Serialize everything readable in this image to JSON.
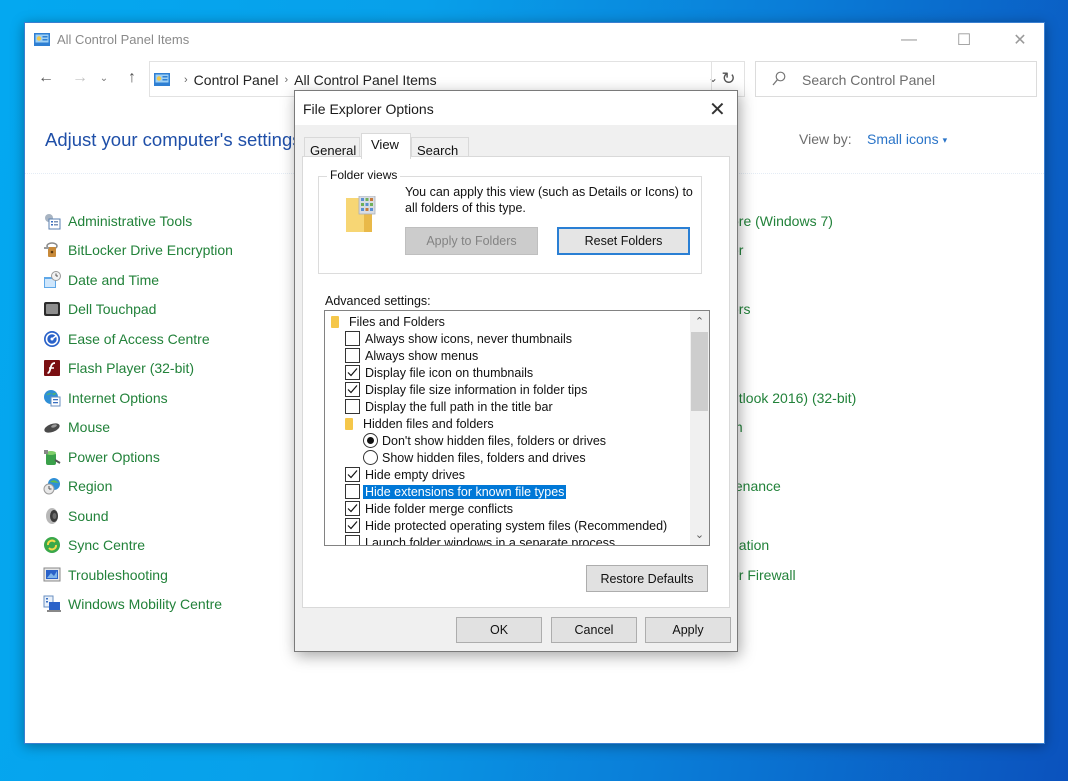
{
  "window": {
    "title": "All Control Panel Items",
    "controls": {
      "minimize": "—",
      "maximize": "☐",
      "close": "✕"
    }
  },
  "nav": {
    "back": "←",
    "forward": "→",
    "recent": "⌄",
    "up": "↑",
    "breadcrumbs": [
      "Control Panel",
      "All Control Panel Items"
    ],
    "separator": "›",
    "dropdown": "⌄",
    "refresh": "↻"
  },
  "search": {
    "placeholder": "Search Control Panel"
  },
  "main": {
    "heading": "Adjust your computer's settings",
    "view_by_label": "View by:",
    "view_by_value": "Small icons",
    "view_by_caret": "▾",
    "items_left": [
      {
        "label": "Administrative Tools",
        "icon": "admin-tools-icon"
      },
      {
        "label": "BitLocker Drive Encryption",
        "icon": "bitlocker-icon"
      },
      {
        "label": "Date and Time",
        "icon": "date-time-icon"
      },
      {
        "label": "Dell Touchpad",
        "icon": "touchpad-icon"
      },
      {
        "label": "Ease of Access Centre",
        "icon": "ease-of-access-icon"
      },
      {
        "label": "Flash Player (32-bit)",
        "icon": "flash-player-icon"
      },
      {
        "label": "Internet Options",
        "icon": "internet-options-icon"
      },
      {
        "label": "Mouse",
        "icon": "mouse-icon"
      },
      {
        "label": "Power Options",
        "icon": "power-options-icon"
      },
      {
        "label": "Region",
        "icon": "region-icon"
      },
      {
        "label": "Sound",
        "icon": "sound-icon"
      },
      {
        "label": "Sync Centre",
        "icon": "sync-centre-icon"
      },
      {
        "label": "Troubleshooting",
        "icon": "troubleshooting-icon"
      },
      {
        "label": "Windows Mobility Centre",
        "icon": "mobility-centre-icon"
      }
    ],
    "items_right_partial": [
      "ore (Windows 7)",
      "er",
      "",
      "ers",
      "",
      "",
      "utlook 2016) (32-bit)",
      "m",
      "",
      "tenance",
      "",
      "gation",
      "er Firewall"
    ]
  },
  "dialog": {
    "title": "File Explorer Options",
    "close": "✕",
    "tabs": [
      "General",
      "View",
      "Search"
    ],
    "active_tab": "View",
    "folder_views": {
      "label": "Folder views",
      "description": "You can apply this view (such as Details or Icons) to all folders of this type.",
      "apply_button": "Apply to Folders",
      "reset_button": "Reset Folders"
    },
    "advanced_label": "Advanced settings:",
    "tree": [
      {
        "type": "folder",
        "level": 0,
        "label": "Files and Folders"
      },
      {
        "type": "checkbox",
        "level": 1,
        "label": "Always show icons, never thumbnails",
        "checked": false
      },
      {
        "type": "checkbox",
        "level": 1,
        "label": "Always show menus",
        "checked": false
      },
      {
        "type": "checkbox",
        "level": 1,
        "label": "Display file icon on thumbnails",
        "checked": true
      },
      {
        "type": "checkbox",
        "level": 1,
        "label": "Display file size information in folder tips",
        "checked": true
      },
      {
        "type": "checkbox",
        "level": 1,
        "label": "Display the full path in the title bar",
        "checked": false
      },
      {
        "type": "folder",
        "level": 1,
        "label": "Hidden files and folders"
      },
      {
        "type": "radio",
        "level": 2,
        "label": "Don't show hidden files, folders or drives",
        "checked": true
      },
      {
        "type": "radio",
        "level": 2,
        "label": "Show hidden files, folders and drives",
        "checked": false
      },
      {
        "type": "checkbox",
        "level": 1,
        "label": "Hide empty drives",
        "checked": true
      },
      {
        "type": "checkbox",
        "level": 1,
        "label": "Hide extensions for known file types",
        "checked": false,
        "selected": true
      },
      {
        "type": "checkbox",
        "level": 1,
        "label": "Hide folder merge conflicts",
        "checked": true
      },
      {
        "type": "checkbox",
        "level": 1,
        "label": "Hide protected operating system files (Recommended)",
        "checked": true
      },
      {
        "type": "checkbox",
        "level": 1,
        "label": "Launch folder windows in a separate process",
        "checked": false
      }
    ],
    "scroll": {
      "up": "⌃",
      "down": "⌄",
      "position_fraction": 0.0,
      "visible_fraction": 0.38
    },
    "restore_defaults": "Restore Defaults",
    "ok": "OK",
    "cancel": "Cancel",
    "apply": "Apply"
  },
  "colors": {
    "link_green": "#22823a",
    "heading_blue": "#1f4fa8",
    "selection_blue": "#0078d7",
    "focus_blue": "#2a7fd4"
  }
}
